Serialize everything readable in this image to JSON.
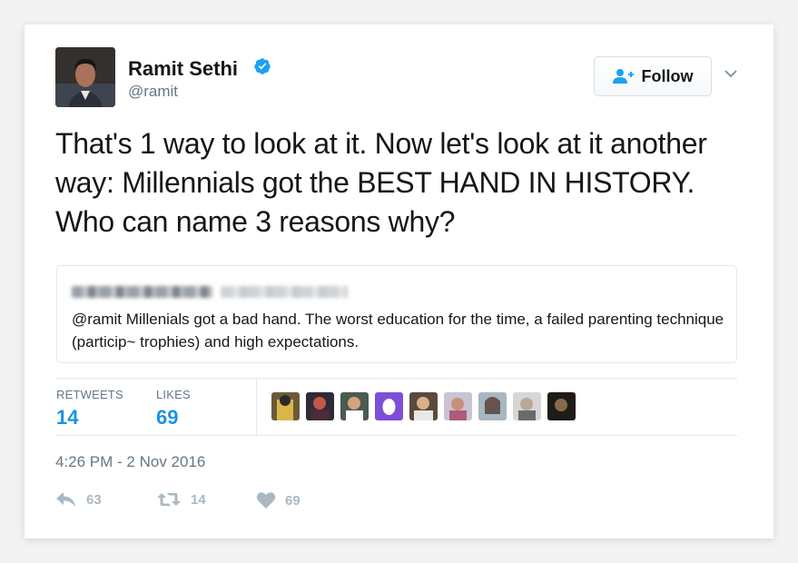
{
  "author": {
    "name": "Ramit Sethi",
    "handle": "@ramit",
    "verified": true
  },
  "follow_button": {
    "label": "Follow"
  },
  "tweet": {
    "text": "That's 1 way to look at it. Now let's look at it another way: Millennials got the BEST HAND IN HISTORY. Who can name 3 reasons why?"
  },
  "quoted_tweet": {
    "text": "@ramit Millenials got a bad hand. The worst education for the time, a failed parenting technique (particip~ trophies) and high expectations."
  },
  "stats": {
    "retweets_label": "RETWEETS",
    "retweets_value": "14",
    "likes_label": "LIKES",
    "likes_value": "69"
  },
  "timestamp": "4:26 PM - 2 Nov 2016",
  "actions": {
    "reply_count": "63",
    "retweet_count": "14",
    "like_count": "69"
  },
  "colors": {
    "accent": "#1b95e0",
    "verified": "#1da1f2",
    "muted": "#657786",
    "action_gray": "#aab8c2"
  },
  "icons": [
    "verified-badge-icon",
    "follow-user-plus-icon",
    "chevron-down-icon",
    "reply-icon",
    "retweet-icon",
    "heart-icon"
  ]
}
